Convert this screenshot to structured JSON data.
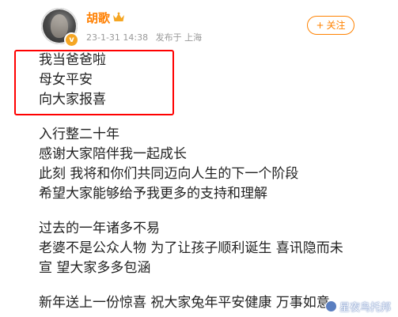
{
  "post": {
    "author": {
      "name": "胡歌",
      "crown_icon": "crown-icon",
      "verified_icon": "verified-badge-icon"
    },
    "meta": {
      "timestamp": "23-1-31 14:38",
      "published_from": "发布于 上海"
    },
    "follow_button": {
      "label": "关注",
      "icon": "plus-icon"
    },
    "highlighted_lines": [
      "我当爸爸啦",
      "母女平安",
      "向大家报喜"
    ],
    "paragraph_1": [
      "入行整二十年",
      "感谢大家陪伴我一起成长",
      "此刻 我将和你们共同迈向人生的下一个阶段",
      "希望大家能够给予我更多的支持和理解"
    ],
    "paragraph_2": [
      "过去的一年诸多不易",
      "老婆不是公众人物 为了让孩子顺利诞生 喜讯隐而未",
      "宣 望大家多多包涵"
    ],
    "paragraph_3": [
      "新年送上一份惊喜 祝大家兔年平安健康 万事如意"
    ]
  },
  "watermark": {
    "text": "星夜鸟托邦"
  },
  "colors": {
    "accent": "#ff8200",
    "username": "#ff7f00",
    "highlight_border": "#ff0000",
    "meta_text": "#999999",
    "body_text": "#222222"
  }
}
